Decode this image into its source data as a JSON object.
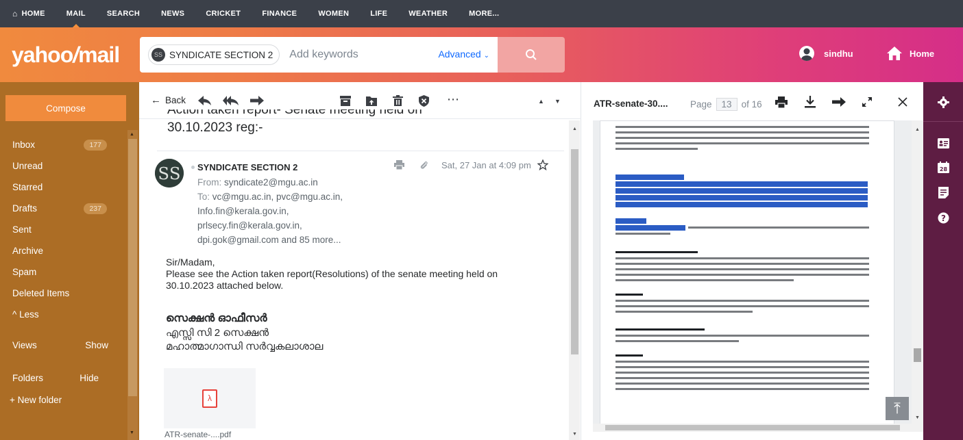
{
  "nav": {
    "items": [
      "HOME",
      "MAIL",
      "SEARCH",
      "NEWS",
      "CRICKET",
      "FINANCE",
      "WOMEN",
      "LIFE",
      "WEATHER",
      "MORE..."
    ],
    "active": "MAIL"
  },
  "header": {
    "logo": "yahoo!mail",
    "search_chip": "SYNDICATE SECTION 2",
    "search_placeholder": "Add keywords",
    "advanced": "Advanced",
    "user": "sindhu",
    "home": "Home"
  },
  "sidebar": {
    "compose": "Compose",
    "folders": [
      {
        "label": "Inbox",
        "count": "177"
      },
      {
        "label": "Unread",
        "count": ""
      },
      {
        "label": "Starred",
        "count": ""
      },
      {
        "label": "Drafts",
        "count": "237"
      },
      {
        "label": "Sent",
        "count": ""
      },
      {
        "label": "Archive",
        "count": ""
      },
      {
        "label": "Spam",
        "count": ""
      },
      {
        "label": "Deleted Items",
        "count": ""
      },
      {
        "label": "^ Less",
        "count": ""
      }
    ],
    "views": "Views",
    "views_action": "Show",
    "folders_label": "Folders",
    "folders_action": "Hide",
    "new_folder": "+ New folder"
  },
  "message": {
    "back": "Back",
    "subject_cut": "Action taken report- Senate meeting held on",
    "subject_line2": "30.10.2023 reg:-",
    "from_name": "SYNDICATE SECTION 2",
    "date": "Sat, 27 Jan at 4:09 pm",
    "from_label": "From:",
    "from_addr": "syndicate2@mgu.ac.in",
    "to_label": "To:",
    "to_1": "vc@mgu.ac.in,  pvc@mgu.ac.in,",
    "to_2": "Info.fin@kerala.gov.in,",
    "to_3": "prlsecy.fin@kerala.gov.in,",
    "to_4": "dpi.gok@gmail.com  and 85 more...",
    "greeting": "Sir/Madam,",
    "body_1": "Please see the Action taken report(Resolutions) of the senate meeting held on",
    "body_2": "30.10.2023 attached below.",
    "sig_1": "സെക്ഷൻ ഓഫീസർ",
    "sig_2": "എസ്സി സി 2 സെക്ഷൻ",
    "sig_3": "മഹാത്മാഗാന്ധി സർവ്വകലാശാല",
    "attachment": "ATR-senate-....pdf"
  },
  "pdf": {
    "title": "ATR-senate-30....",
    "page_label": "Page",
    "page_current": "13",
    "page_total": "of 16"
  },
  "colors": {
    "nav_bg": "#3b4049",
    "sidebar_bg": "#ac6d25",
    "compose_bg": "#f08b3d",
    "rail_bg": "#5e1d43",
    "accent": "#0f69ff",
    "highlight": "#2b5cc4"
  },
  "icons": [
    "home-icon",
    "search-icon",
    "chevron-down-icon",
    "user-icon",
    "back-arrow-icon",
    "reply-icon",
    "reply-all-icon",
    "forward-icon",
    "archive-icon",
    "move-icon",
    "delete-icon",
    "spam-icon",
    "more-icon",
    "prev-icon",
    "next-icon",
    "print-icon",
    "attachment-clip-icon",
    "star-icon",
    "pdf-icon",
    "download-icon",
    "expand-icon",
    "close-icon",
    "gear-icon",
    "contacts-icon",
    "calendar-icon",
    "notepad-icon",
    "help-icon",
    "scroll-top-icon"
  ]
}
